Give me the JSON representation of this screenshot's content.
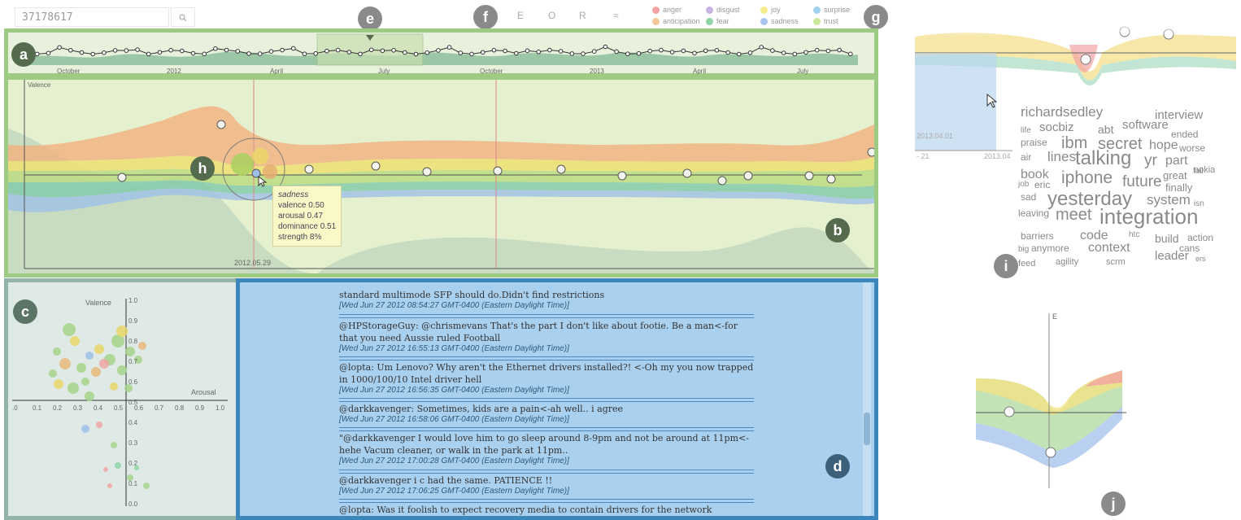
{
  "search": {
    "value": "37178617",
    "button_icon": "search-icon"
  },
  "mode_buttons": [
    "E",
    "O",
    "R"
  ],
  "extra_icon": "≈",
  "emotion_legend": [
    {
      "label": "anger",
      "color": "#f4a3a3"
    },
    {
      "label": "anticipation",
      "color": "#f6c79a"
    },
    {
      "label": "disgust",
      "color": "#c9b2e0"
    },
    {
      "label": "fear",
      "color": "#8fd3a6"
    },
    {
      "label": "joy",
      "color": "#f4ec8c"
    },
    {
      "label": "sadness",
      "color": "#a9c4ec"
    },
    {
      "label": "surprise",
      "color": "#9fd0ee"
    },
    {
      "label": "trust",
      "color": "#c8e79a"
    }
  ],
  "badges": {
    "a": "a",
    "b": "b",
    "c": "c",
    "d": "d",
    "e": "e",
    "f": "f",
    "g": "g",
    "h": "h",
    "i": "i",
    "j": "j"
  },
  "timeline": {
    "month_labels": [
      "October",
      "2012",
      "April",
      "July",
      "October",
      "2013",
      "April",
      "July"
    ]
  },
  "stream": {
    "y_axis_label": "Valence",
    "date_label": "2012.05.29"
  },
  "tooltip": {
    "emotion": "sadness",
    "valence": "valence 0.50",
    "arousal": "arousal 0.47",
    "dominance": "dominance 0.51",
    "strength": "strength 8%"
  },
  "scatter": {
    "y_label": "Valence",
    "x_label": "Arousal",
    "y_ticks": [
      "1.0",
      "0.9",
      "0.8",
      "0.7",
      "0.6",
      "0.5",
      "0.4",
      "0.3",
      "0.2",
      "0.1",
      "0.0"
    ],
    "x_ticks": [
      ".0",
      "0.1",
      "0.2",
      "0.3",
      "0.4",
      "0.5",
      "0.6",
      "0.7",
      "0.8",
      "0.9",
      "1.0"
    ]
  },
  "tweets": [
    {
      "text": "standard multimode SFP should do.Didn't find restrictions",
      "time": "[Wed Jun 27 2012 08:54:27 GMT-0400 (Eastern Daylight Time)]"
    },
    {
      "text": "@HPStorageGuy: @chrismevans That's the part I don't like about footie. Be a man<-for that you need Aussie ruled Football",
      "time": "[Wed Jun 27 2012 16:55:13 GMT-0400 (Eastern Daylight Time)]"
    },
    {
      "text": "@lopta: Um Lenovo? Why aren't the Ethernet drivers installed?! <-Oh my you now trapped in 1000/100/10 Intel driver hell",
      "time": "[Wed Jun 27 2012 16:56:35 GMT-0400 (Eastern Daylight Time)]"
    },
    {
      "text": "@darkkavenger: Sometimes, kids are a pain<-ah well.. i agree",
      "time": "[Wed Jun 27 2012 16:58:06 GMT-0400 (Eastern Daylight Time)]"
    },
    {
      "text": "\"@darkkavenger I would love him to go sleep around 8-9pm and not be around at 11pm<-hehe Vacum cleaner, or walk in the park at 11pm..",
      "time": "[Wed Jun 27 2012 17:00:28 GMT-0400 (Eastern Daylight Time)]"
    },
    {
      "text": "@darkkavenger i c had the same. PATIENCE !!",
      "time": "[Wed Jun 27 2012 17:06:25 GMT-0400 (Eastern Daylight Time)]"
    },
    {
      "text": "@lopta: Was it foolish to expect recovery media to contain drivers for the network adaptor<-No :)",
      "time": ""
    }
  ],
  "zoom_i": {
    "date_left": "2013.04.01",
    "tick_left": "- 21",
    "tick_right": "2013.04"
  },
  "wordcloud": [
    {
      "w": "richardsedley",
      "s": 17
    },
    {
      "w": "interview",
      "s": 15
    },
    {
      "w": "life",
      "s": 10
    },
    {
      "w": "socbiz",
      "s": 15
    },
    {
      "w": "abt",
      "s": 14
    },
    {
      "w": "software",
      "s": 15
    },
    {
      "w": "ended",
      "s": 12
    },
    {
      "w": "praise",
      "s": 12
    },
    {
      "w": "ibm",
      "s": 20
    },
    {
      "w": "secret",
      "s": 20
    },
    {
      "w": "hope",
      "s": 16
    },
    {
      "w": "worse",
      "s": 12
    },
    {
      "w": "air",
      "s": 12
    },
    {
      "w": "lines",
      "s": 17
    },
    {
      "w": "talking",
      "s": 24
    },
    {
      "w": "yr",
      "s": 19
    },
    {
      "w": "part",
      "s": 16
    },
    {
      "w": "nokia",
      "s": 11
    },
    {
      "w": "book",
      "s": 16
    },
    {
      "w": "iphone",
      "s": 21
    },
    {
      "w": "future",
      "s": 19
    },
    {
      "w": "great",
      "s": 13
    },
    {
      "w": "fail",
      "s": 10
    },
    {
      "w": "job",
      "s": 10
    },
    {
      "w": "eric",
      "s": 12
    },
    {
      "w": "finally",
      "s": 13
    },
    {
      "w": "sad",
      "s": 12
    },
    {
      "w": "yesterday",
      "s": 24
    },
    {
      "w": "system",
      "s": 17
    },
    {
      "w": "isn",
      "s": 10
    },
    {
      "w": "leaving",
      "s": 12
    },
    {
      "w": "meet",
      "s": 20
    },
    {
      "w": "integration",
      "s": 26
    },
    {
      "w": "barriers",
      "s": 12
    },
    {
      "w": "code",
      "s": 16
    },
    {
      "w": "htc",
      "s": 10
    },
    {
      "w": "build",
      "s": 14
    },
    {
      "w": "action",
      "s": 12
    },
    {
      "w": "big",
      "s": 10
    },
    {
      "w": "anymore",
      "s": 12
    },
    {
      "w": "context",
      "s": 16
    },
    {
      "w": "cans",
      "s": 12
    },
    {
      "w": "feed",
      "s": 11
    },
    {
      "w": "agility",
      "s": 11
    },
    {
      "w": "scrm",
      "s": 11
    },
    {
      "w": "leader",
      "s": 15
    },
    {
      "w": "ers",
      "s": 9
    }
  ],
  "zoom_j": {
    "axis_label": "E"
  }
}
